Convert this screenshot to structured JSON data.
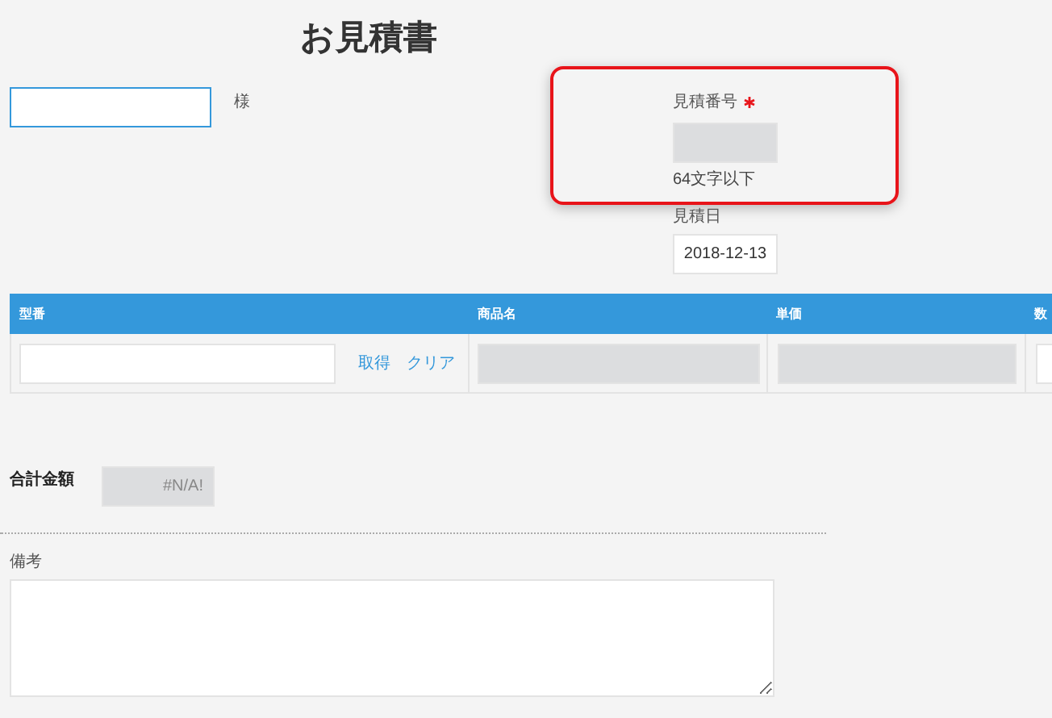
{
  "title": "お見積書",
  "customer": {
    "suffix": "様",
    "focused": true
  },
  "estimate_number": {
    "label": "見積番号",
    "required": true,
    "hint": "64文字以下",
    "highlighted": true
  },
  "estimate_date": {
    "label": "見積日",
    "value": "2018-12-13"
  },
  "table": {
    "columns": [
      "型番",
      "商品名",
      "単価",
      "数"
    ],
    "row": {
      "actions": [
        "取得",
        "クリア"
      ]
    }
  },
  "total": {
    "label": "合計金額",
    "value": "#N/A!"
  },
  "notes": {
    "label": "備考"
  }
}
